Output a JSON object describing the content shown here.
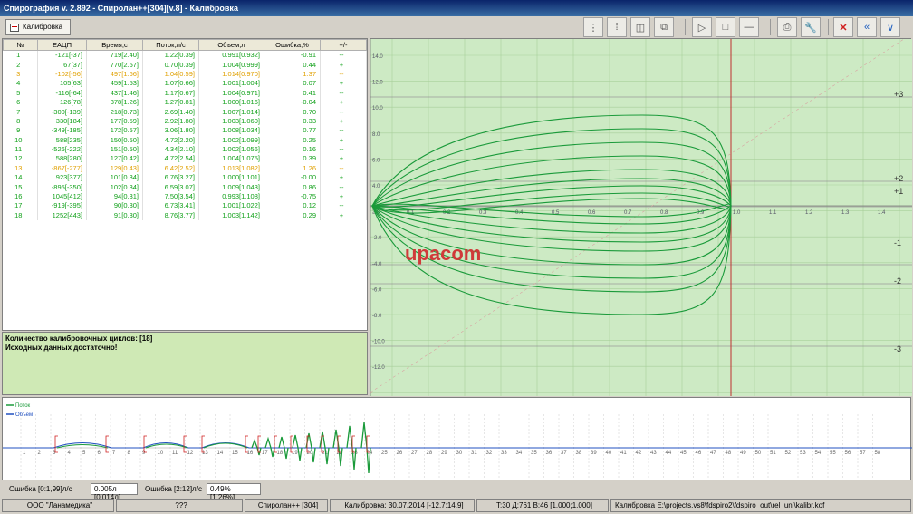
{
  "window": {
    "title": "Спирография v. 2.892 - Спиролан++[304][v.8] - Калибровка"
  },
  "toolbar": {
    "tab_label": "Калибровка",
    "buttons": [
      "tool-a",
      "tool-b",
      "save",
      "copy",
      "play",
      "stop",
      "minus",
      "print",
      "wrench",
      "close-red",
      "rewind",
      "down"
    ]
  },
  "table": {
    "headers": [
      "№",
      "ЕАЦП",
      "Время,с",
      "Поток,л/с",
      "Объем,л",
      "Ошибка,%",
      "+/-"
    ],
    "rows": [
      {
        "status": "ok",
        "cells": [
          "1",
          "-121[-37]",
          "719[2.40]",
          "1.22[0.39]",
          "0.991[0.932]",
          "-0.91",
          "--"
        ]
      },
      {
        "status": "ok",
        "cells": [
          "2",
          "67[37]",
          "770[2.57]",
          "0.70[0.39]",
          "1.004[0.999]",
          "0.44",
          "+"
        ]
      },
      {
        "status": "warn",
        "cells": [
          "3",
          "-102[-56]",
          "497[1.66]",
          "1.04[0.59]",
          "1.014[0.970]",
          "1.37",
          "--"
        ]
      },
      {
        "status": "ok",
        "cells": [
          "4",
          "105[63]",
          "459[1.53]",
          "1.07[0.66]",
          "1.001[1.004]",
          "0.07",
          "+"
        ]
      },
      {
        "status": "ok",
        "cells": [
          "5",
          "-116[-64]",
          "437[1.46]",
          "1.17[0.67]",
          "1.004[0.971]",
          "0.41",
          "--"
        ]
      },
      {
        "status": "ok",
        "cells": [
          "6",
          "126[78]",
          "378[1.26]",
          "1.27[0.81]",
          "1.000[1.016]",
          "-0.04",
          "+"
        ]
      },
      {
        "status": "ok",
        "cells": [
          "7",
          "-300[-139]",
          "218[0.73]",
          "2.69[1.40]",
          "1.007[1.014]",
          "0.70",
          "--"
        ]
      },
      {
        "status": "ok",
        "cells": [
          "8",
          "330[184]",
          "177[0.59]",
          "2.92[1.80]",
          "1.003[1.060]",
          "0.33",
          "+"
        ]
      },
      {
        "status": "ok",
        "cells": [
          "9",
          "-349[-185]",
          "172[0.57]",
          "3.06[1.80]",
          "1.008[1.034]",
          "0.77",
          "--"
        ]
      },
      {
        "status": "ok",
        "cells": [
          "10",
          "588[235]",
          "150[0.50]",
          "4.72[2.20]",
          "1.002[1.099]",
          "0.25",
          "+"
        ]
      },
      {
        "status": "ok",
        "cells": [
          "11",
          "-526[-222]",
          "151[0.50]",
          "4.34[2.10]",
          "1.002[1.056]",
          "0.16",
          "--"
        ]
      },
      {
        "status": "ok",
        "cells": [
          "12",
          "588[280]",
          "127[0.42]",
          "4.72[2.54]",
          "1.004[1.075]",
          "0.39",
          "+"
        ]
      },
      {
        "status": "warn",
        "cells": [
          "13",
          "-867[-277]",
          "129[0.43]",
          "6.42[2.52]",
          "1.013[1.082]",
          "1.26",
          "--"
        ]
      },
      {
        "status": "ok",
        "cells": [
          "14",
          "923[377]",
          "101[0.34]",
          "6.76[3.27]",
          "1.000[1.101]",
          "-0.00",
          "+"
        ]
      },
      {
        "status": "ok",
        "cells": [
          "15",
          "-895[-350]",
          "102[0.34]",
          "6.59[3.07]",
          "1.009[1.043]",
          "0.86",
          "--"
        ]
      },
      {
        "status": "ok",
        "cells": [
          "16",
          "1045[412]",
          "94[0.31]",
          "7.50[3.54]",
          "0.993[1.108]",
          "-0.75",
          "+"
        ]
      },
      {
        "status": "ok",
        "cells": [
          "17",
          "-919[-395]",
          "90[0.30]",
          "6.73[3.41]",
          "1.001[1.022]",
          "0.12",
          "--"
        ]
      },
      {
        "status": "ok",
        "cells": [
          "18",
          "1252[443]",
          "91[0.30]",
          "8.76[3.77]",
          "1.003[1.142]",
          "0.29",
          "+"
        ]
      }
    ]
  },
  "messages": {
    "line1": "Количество калибровочных циклов: [18]",
    "line2": "Исходных данных достаточно!"
  },
  "plot": {
    "watermark": "upacom",
    "y_ticks": [
      "14.0",
      "12.0",
      "10.0",
      "8.0",
      "6.0",
      "4.0",
      "2.0",
      "-2.0",
      "-4.0",
      "-6.0",
      "-8.0",
      "-10.0",
      "-12.0"
    ],
    "x_ticks": [
      "0.1",
      "0.2",
      "0.3",
      "0.4",
      "0.5",
      "0.6",
      "0.7",
      "0.8",
      "0.9",
      "1.0",
      "1.1",
      "1.2",
      "1.3",
      "1.4"
    ],
    "right_labels": [
      "+3",
      "+2",
      "+1",
      "-1",
      "-2",
      "-3"
    ],
    "colors": {
      "bg": "#cdeac4",
      "loop": "#1a9a3a",
      "marker": "#c03030"
    }
  },
  "timeline": {
    "legend": {
      "flow": "Поток",
      "volume": "Объем"
    },
    "legend_colors": {
      "flow": "#1a9a3a",
      "volume": "#2050c0"
    },
    "tick_count": 58
  },
  "errors": {
    "label1": "Ошибка [0:1,99]л/с",
    "value1": "0.005л [0.014л]",
    "label2": "Ошибка [2:12]л/с",
    "value2": "0.49% [1.26%]"
  },
  "statusbar": {
    "company": "ООО \"Ланамедика\"",
    "unknown": "???",
    "device": "Спиролан++ [304]",
    "calibration": "Калибровка: 30.07.2014 [-12.7:14.9]",
    "coeffs": "T:30 Д:761 В:46 [1.000;1.000]",
    "file": "Калибровка E:\\projects.vs8\\fdspiro2\\fdspiro_out\\rel_uni\\kalibr.kof"
  }
}
